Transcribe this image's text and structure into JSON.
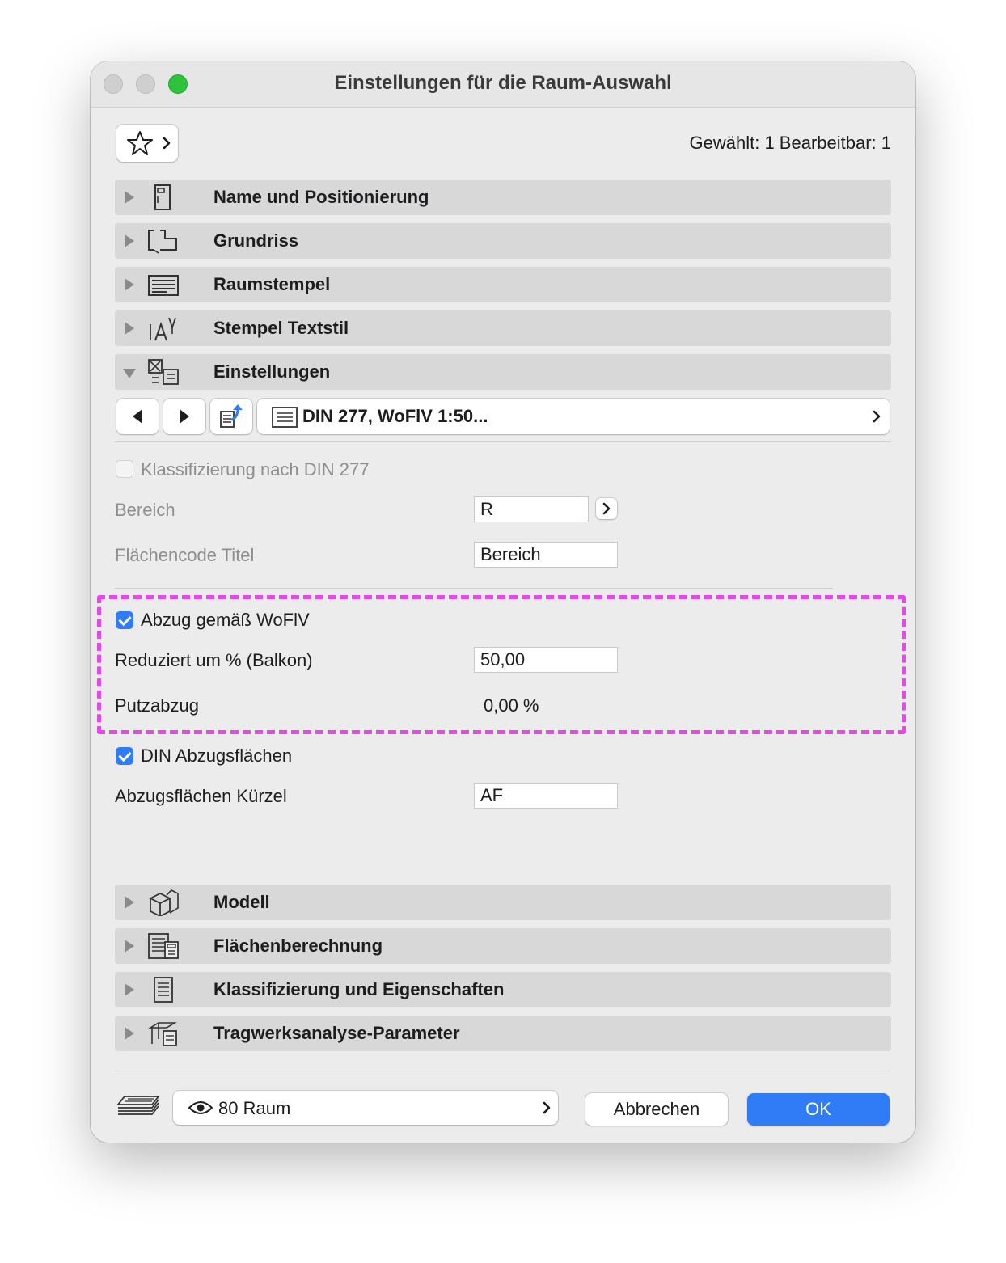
{
  "window": {
    "title": "Einstellungen für die Raum-Auswahl"
  },
  "header": {
    "selection_count": "Gewählt: 1 Bearbeitbar: 1"
  },
  "sections_top": [
    {
      "label": "Name und Positionierung",
      "icon": "name-position-icon"
    },
    {
      "label": "Grundriss",
      "icon": "floor-plan-icon"
    },
    {
      "label": "Raumstempel",
      "icon": "zone-stamp-icon"
    },
    {
      "label": "Stempel Textstil",
      "icon": "text-style-icon"
    },
    {
      "label": "Einstellungen",
      "icon": "settings-icon"
    }
  ],
  "settings": {
    "preset_label": "DIN 277, WoFlV 1:50...",
    "classification_label": "Klassifizierung nach DIN 277",
    "classification_checked": false,
    "bereich_label": "Bereich",
    "bereich_value": "R",
    "flaechencode_label": "Flächencode Titel",
    "flaechencode_value": "Bereich",
    "abzug_label": "Abzug gemäß WoFlV",
    "abzug_checked": true,
    "reduziert_label": "Reduziert um % (Balkon)",
    "reduziert_value": "50,00",
    "putzabzug_label": "Putzabzug",
    "putzabzug_value": "0,00 %",
    "din_abzug_label": "DIN Abzugsflächen",
    "din_abzug_checked": true,
    "kuerzel_label": "Abzugsflächen Kürzel",
    "kuerzel_value": "AF"
  },
  "sections_bottom": [
    {
      "label": "Modell",
      "icon": "model-icon"
    },
    {
      "label": "Flächenberechnung",
      "icon": "area-calculation-icon"
    },
    {
      "label": "Klassifizierung und Eigenschaften",
      "icon": "classification-icon"
    },
    {
      "label": "Tragwerksanalyse-Parameter",
      "icon": "structural-analysis-icon"
    }
  ],
  "footer": {
    "layer_label": "80 Raum",
    "cancel_label": "Abbrechen",
    "ok_label": "OK"
  },
  "colors": {
    "accent": "#2f7cf6",
    "highlight": "#e34ae6",
    "window_bg": "#ececec",
    "section_bg": "#d8d8d8"
  }
}
